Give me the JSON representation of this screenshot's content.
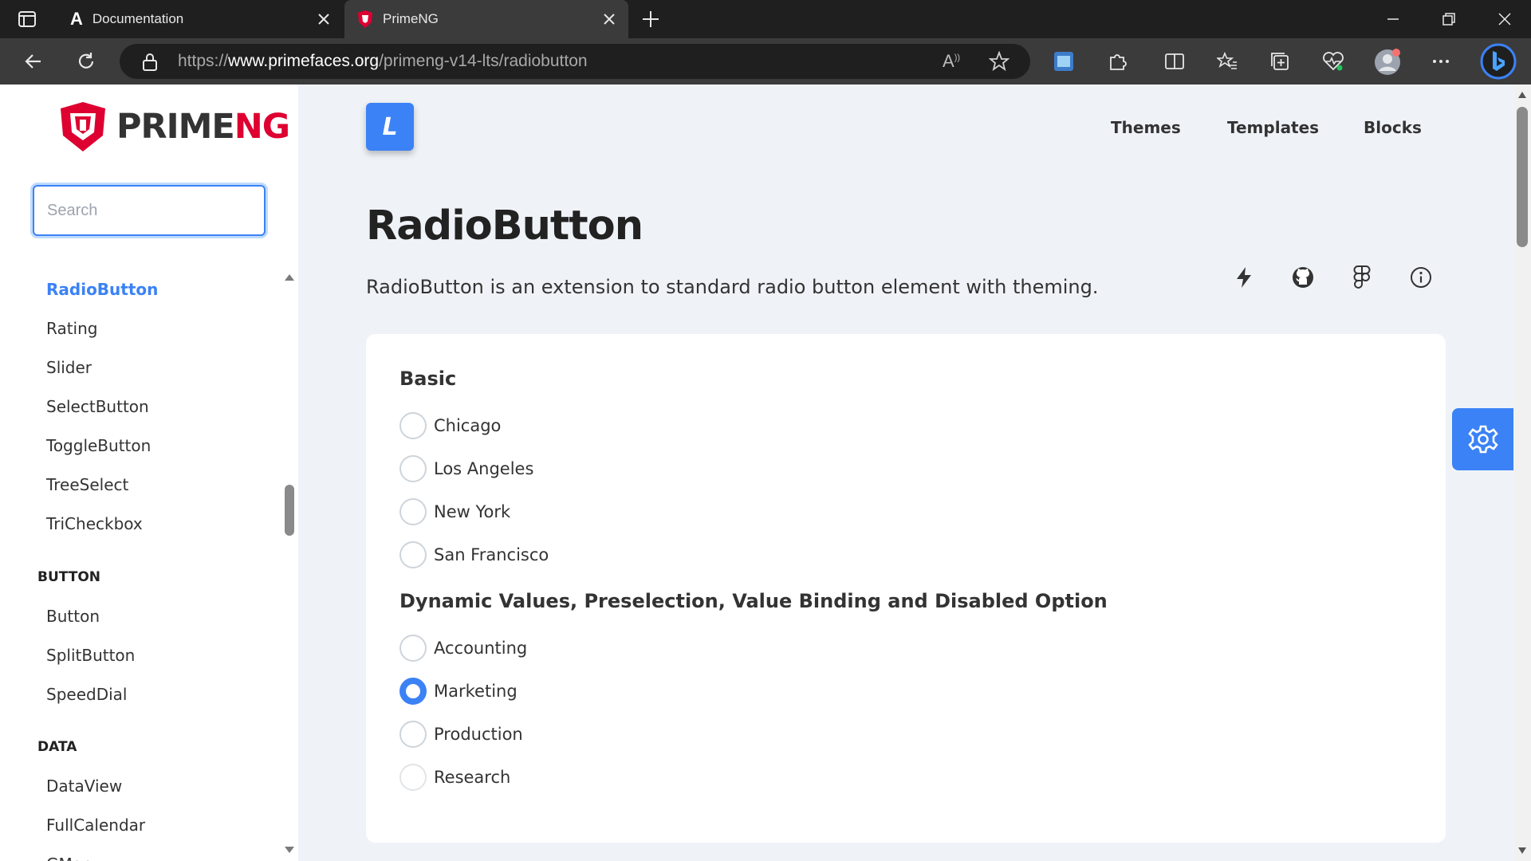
{
  "browser": {
    "tabs": [
      {
        "title": "Documentation",
        "icon": "angular-icon"
      },
      {
        "title": "PrimeNG",
        "icon": "primeng-shield-icon"
      }
    ],
    "url": {
      "prefix": "https://",
      "domain": "www.primefaces.org",
      "path": "/primeng-v14-lts/radiobutton"
    }
  },
  "sidebar": {
    "logo": {
      "prime": "PRIME",
      "ng": "NG"
    },
    "search_placeholder": "Search",
    "items_top": [
      "RadioButton",
      "Rating",
      "Slider",
      "SelectButton",
      "ToggleButton",
      "TreeSelect",
      "TriCheckbox"
    ],
    "section_button": "BUTTON",
    "items_button": [
      "Button",
      "SplitButton",
      "SpeedDial"
    ],
    "section_data": "DATA",
    "items_data": [
      "DataView",
      "FullCalendar",
      "GMap"
    ]
  },
  "topbar": {
    "logo_letter": "L",
    "nav": [
      "Themes",
      "Templates",
      "Blocks"
    ]
  },
  "main": {
    "title": "RadioButton",
    "description": "RadioButton is an extension to standard radio button element with theming.",
    "basic": {
      "heading": "Basic",
      "options": [
        "Chicago",
        "Los Angeles",
        "New York",
        "San Francisco"
      ]
    },
    "dynamic": {
      "heading": "Dynamic Values, Preselection, Value Binding and Disabled Option",
      "options": [
        "Accounting",
        "Marketing",
        "Production",
        "Research"
      ],
      "selected": "Marketing"
    }
  },
  "colors": {
    "primary": "#3b82f6",
    "brand_red": "#dd0031",
    "page_bg": "#eff3f8"
  }
}
